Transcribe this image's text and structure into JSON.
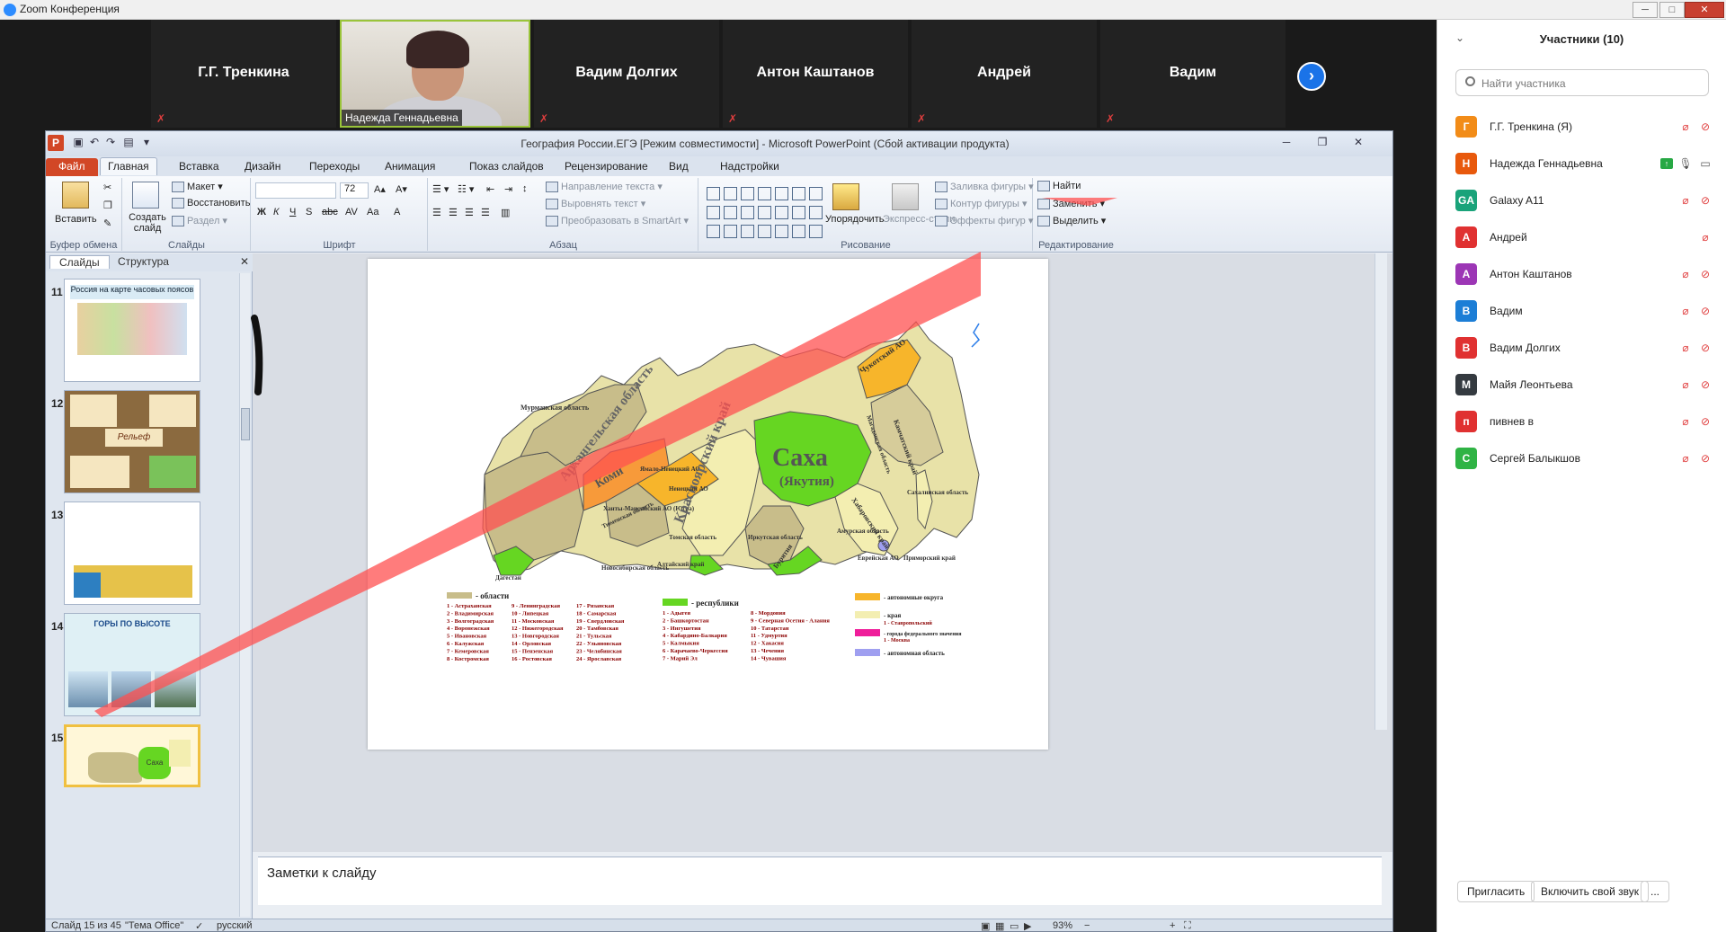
{
  "window": {
    "title": "Zoom Конференция"
  },
  "gallery": {
    "tiles": [
      {
        "name": "Г.Г. Тренкина"
      },
      {
        "name": "Надежда Геннадьевна"
      },
      {
        "name": "Вадим Долгих"
      },
      {
        "name": "Антон Каштанов"
      },
      {
        "name": "Андрей"
      },
      {
        "name": "Вадим"
      }
    ]
  },
  "ppt": {
    "doc_title": "География России.ЕГЭ [Режим совместимости]  -  Microsoft PowerPoint (Сбой активации продукта)",
    "tabs": [
      "Файл",
      "Главная",
      "Вставка",
      "Дизайн",
      "Переходы",
      "Анимация",
      "Показ слайдов",
      "Рецензирование",
      "Вид",
      "Надстройки"
    ],
    "ribbon": {
      "clipboard": {
        "paste": "Вставить",
        "label": "Буфер обмена"
      },
      "slides": {
        "create": "Создать слайд",
        "layout": "Макет",
        "reset": "Восстановить",
        "section": "Раздел",
        "label": "Слайды"
      },
      "font": {
        "size": "72",
        "label": "Шрифт"
      },
      "paragraph": {
        "direction": "Направление текста",
        "align": "Выровнять текст",
        "smartart": "Преобразовать в SmartArt",
        "label": "Абзац"
      },
      "drawing": {
        "arrange": "Упорядочить",
        "styles": "Экспресс-стили",
        "fill": "Заливка фигуры",
        "outline": "Контур фигуры",
        "effects": "Эффекты фигур",
        "label": "Рисование"
      },
      "editing": {
        "find": "Найти",
        "replace": "Заменить",
        "select": "Выделить",
        "label": "Редактирование"
      }
    },
    "pane": {
      "tab_slides": "Слайды",
      "tab_outline": "Структура"
    },
    "thumbnails": [
      {
        "num": "11",
        "title": "Россия на карте часовых поясов"
      },
      {
        "num": "12",
        "title": "Рельеф"
      },
      {
        "num": "13",
        "title": ""
      },
      {
        "num": "14",
        "title": "ГОРЫ ПО ВЫСОТЕ"
      },
      {
        "num": "15",
        "title": "Саха"
      }
    ],
    "slide": {
      "map_labels": {
        "arkh": "Архангельская область",
        "komi": "Коми",
        "kras": "Красноярский край",
        "saha": "Саха",
        "yakutia": "(Якутия)",
        "chuk": "Чукотский АО",
        "murm": "Мурманская область",
        "nenets": "Ненецкий АО",
        "hanty": "Ханты-Мансийский АО (Югра)",
        "yamal": "Ямало-Ненецкий АО",
        "tyumen": "Тюменская область",
        "tomsk": "Томская область",
        "irkutsk": "Иркутская область",
        "amur": "Амурская область",
        "khab": "Хабаровский край",
        "sakhalin": "Сахалинская область",
        "primorye": "Приморский край",
        "buryatia": "Бурятия",
        "dagestan": "Дагестан",
        "novosib": "Новосибирская область",
        "altai": "Алтайский край",
        "kamchatka": "Камчатский край",
        "magadan": "Магаданская область",
        "evr": "Еврейская АО"
      },
      "legend": {
        "oblasti": "- области",
        "respubliki": "- республики",
        "ao": "- автономные округа",
        "kraya": "- края",
        "fed": "- города федерального значения",
        "avt_obl": "- автономная область",
        "colors": {
          "oblasti": "#c8bd8a",
          "respubliki": "#66d622",
          "ao": "#f7b52b",
          "kraya": "#f3eeb1",
          "fed": "#ef1d9a",
          "avt_obl": "#9f9ff0"
        },
        "oblasti_list": [
          "1 - Астраханская",
          "2 - Владимирская",
          "3 - Волгоградская",
          "4 - Воронежская",
          "5 - Ивановская",
          "6 - Калужская",
          "7 - Кемеровская",
          "8 - Костромская",
          "9 - Ленинградская",
          "10 - Липецкая",
          "11 - Московская",
          "12 - Нижегородская",
          "13 - Новгородская",
          "14 - Орловская",
          "15 - Пензенская",
          "16 - Ростовская",
          "17 - Рязанская",
          "18 - Самарская",
          "19 - Свердловская",
          "20 - Тамбовская",
          "21 - Тульская",
          "22 - Ульяновская",
          "23 - Челябинская",
          "24 - Ярославская"
        ],
        "resp_list": [
          "1 - Адыгея",
          "2 - Башкортостан",
          "3 - Ингушетия",
          "4 - Кабардино-Балкария",
          "5 - Калмыкия",
          "6 - Карачаево-Черкессия",
          "7 - Марий Эл",
          "8 - Мордовия",
          "9 - Северная Осетия - Алания",
          "10 - Татарстан",
          "11 - Удмуртия",
          "12 - Хакасия",
          "13 - Чечения",
          "14 - Чувашия"
        ],
        "kraya_list": [
          "1 - Ставропольский"
        ],
        "fed_list": [
          "1 - Москва"
        ]
      }
    },
    "notes_placeholder": "Заметки к слайду",
    "status": {
      "slide": "Слайд 15 из 45",
      "theme": "\"Тема Office\"",
      "lang": "русский",
      "zoom": "93%"
    }
  },
  "panel": {
    "title": "Участники (10)",
    "search_placeholder": "Найти участника",
    "participants": [
      {
        "initials": "Г",
        "name": "Г.Г. Тренкина (Я)",
        "color": "#f28c18"
      },
      {
        "initials": "Н",
        "name": "Надежда Геннадьевна",
        "color": "#e8590c"
      },
      {
        "initials": "GA",
        "name": "Galaxy A11",
        "color": "#1aa37a"
      },
      {
        "initials": "А",
        "name": "Андрей",
        "color": "#e03131"
      },
      {
        "initials": "А",
        "name": "Антон Каштанов",
        "color": "#9c36b5"
      },
      {
        "initials": "В",
        "name": "Вадим",
        "color": "#1c7ed6"
      },
      {
        "initials": "В",
        "name": "Вадим Долгих",
        "color": "#e03131"
      },
      {
        "initials": "М",
        "name": "Майя Леонтьева",
        "color": "#343a40"
      },
      {
        "initials": "п",
        "name": "пивнев в",
        "color": "#e03131"
      },
      {
        "initials": "С",
        "name": "Сергей Балыкшов",
        "color": "#2fb344"
      }
    ],
    "invite": "Пригласить",
    "unmute": "Включить свой звук",
    "more": "..."
  }
}
